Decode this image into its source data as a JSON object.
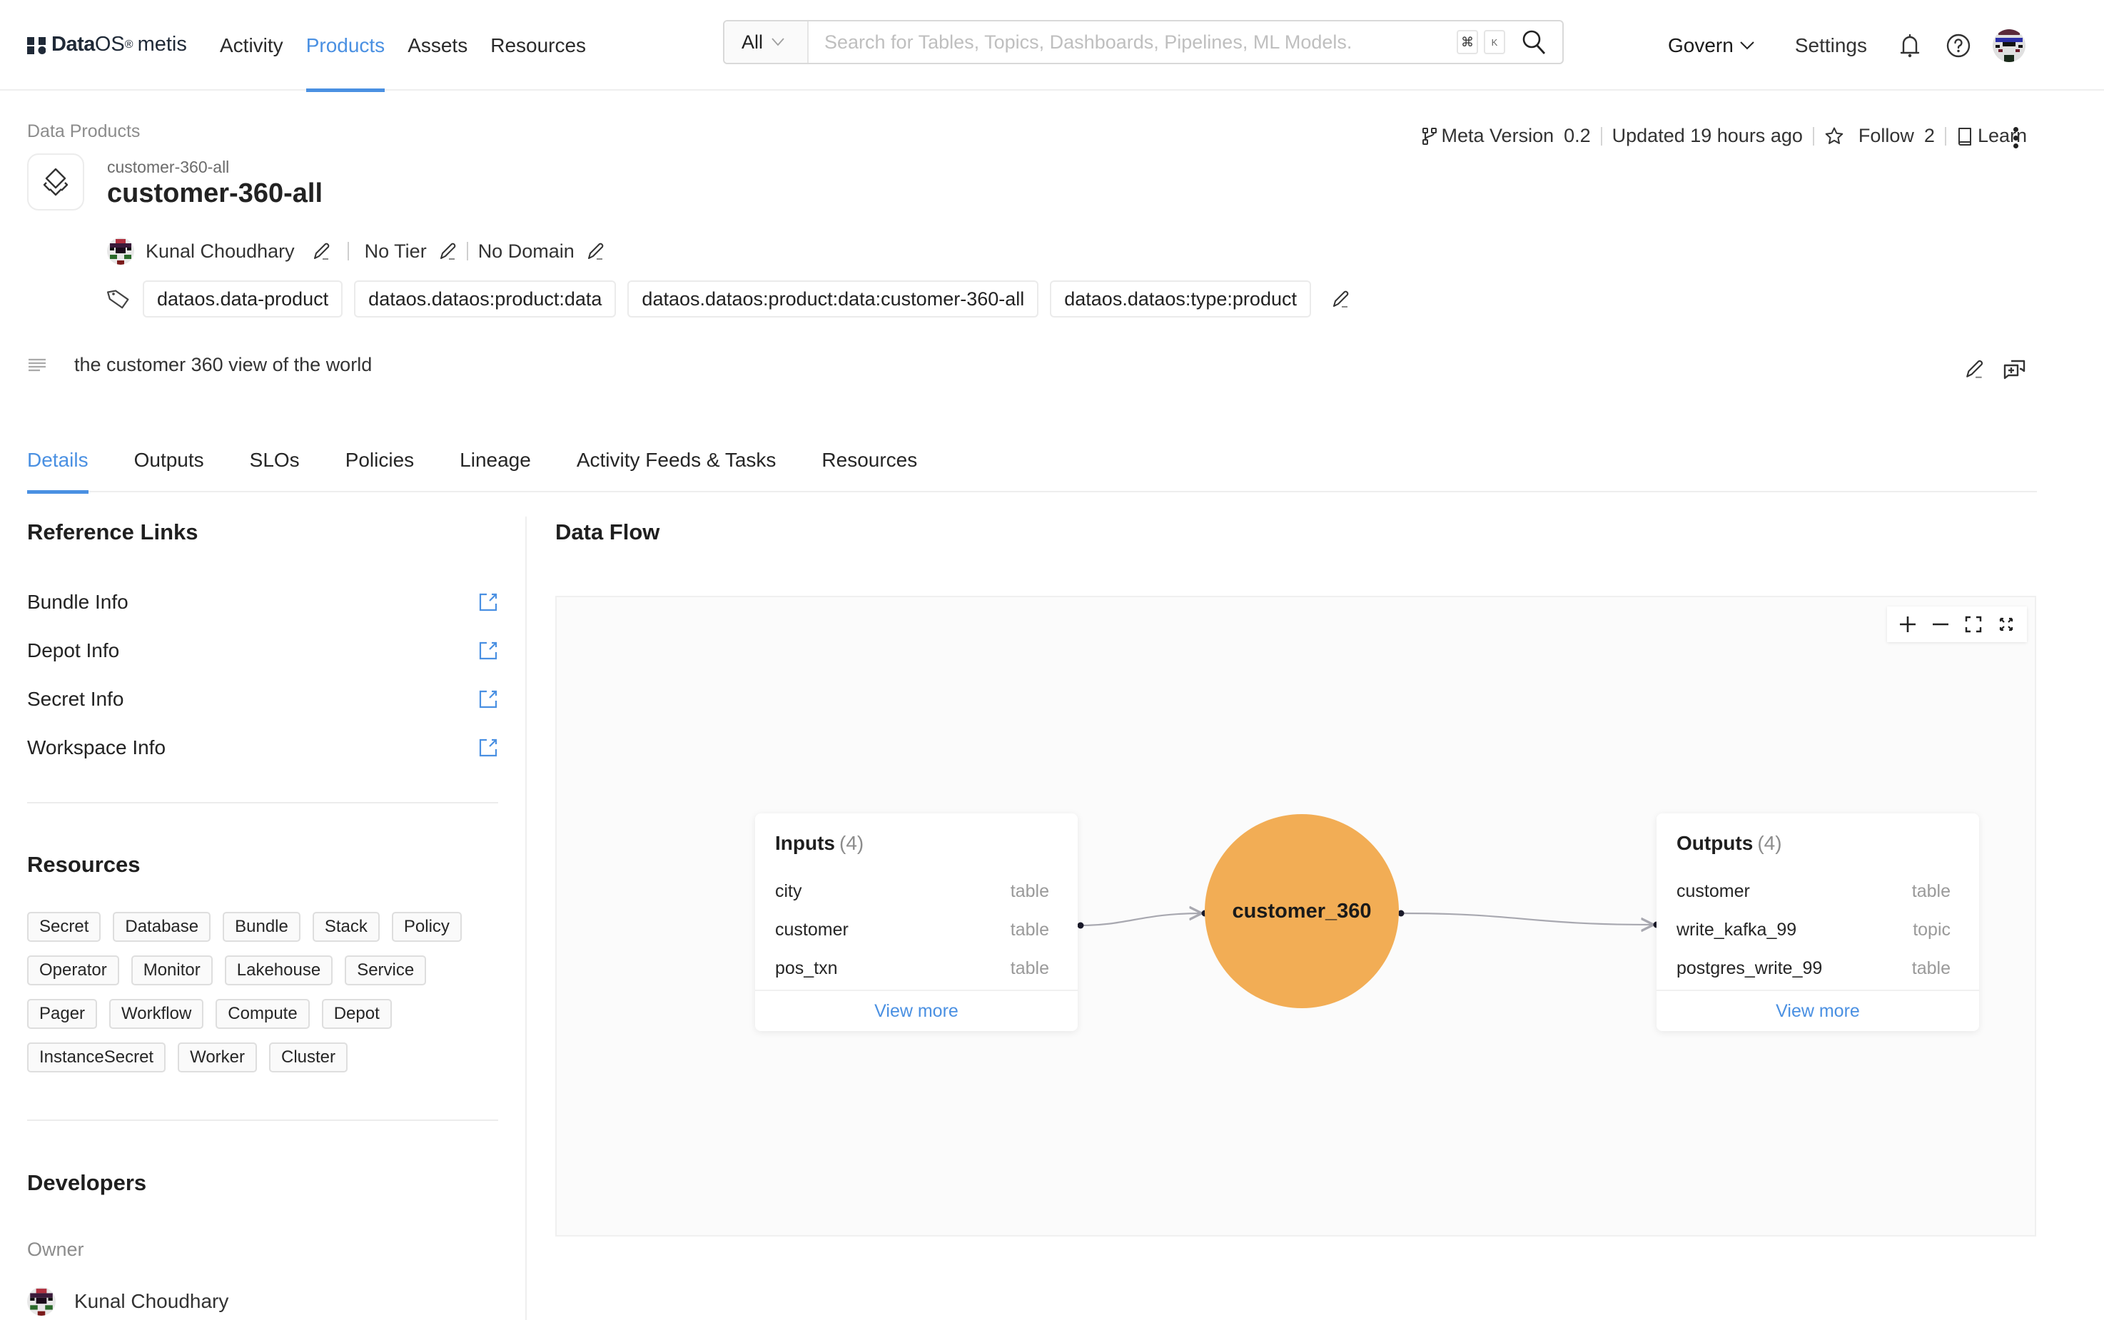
{
  "header": {
    "logo": {
      "brand": "Data",
      "brand_os": "OS",
      "registered": "®",
      "product": "metis"
    },
    "nav": [
      {
        "label": "Activity",
        "active": false
      },
      {
        "label": "Products",
        "active": true
      },
      {
        "label": "Assets",
        "active": false
      },
      {
        "label": "Resources",
        "active": false
      }
    ],
    "search": {
      "type_selected": "All",
      "placeholder": "Search for Tables, Topics, Dashboards, Pipelines, ML Models.",
      "value": "",
      "shortcut_keys": [
        "⌘",
        "K"
      ]
    },
    "govern_label": "Govern",
    "settings_label": "Settings",
    "icons": [
      "bell-icon",
      "help-icon",
      "user-avatar"
    ]
  },
  "entity": {
    "breadcrumb": "Data Products",
    "subtitle": "customer-360-all",
    "title": "customer-360-all",
    "icon": "data-product-icon",
    "meta": {
      "version_label": "Meta Version",
      "version_value": "0.2",
      "updated": "Updated 19 hours ago",
      "follow_label": "Follow",
      "follow_count": "2",
      "learn_label": "Learn"
    },
    "owner": "Kunal Choudhary",
    "tier": "No Tier",
    "domain": "No Domain",
    "tags": [
      "dataos.data-product",
      "dataos.dataos:product:data",
      "dataos.dataos:product:data:customer-360-all",
      "dataos.dataos:type:product"
    ],
    "description": "the customer 360 view of the world"
  },
  "tabs": [
    {
      "label": "Details",
      "active": true
    },
    {
      "label": "Outputs",
      "active": false
    },
    {
      "label": "SLOs",
      "active": false
    },
    {
      "label": "Policies",
      "active": false
    },
    {
      "label": "Lineage",
      "active": false
    },
    {
      "label": "Activity Feeds & Tasks",
      "active": false
    },
    {
      "label": "Resources",
      "active": false
    }
  ],
  "left_panel": {
    "reference_links": {
      "title": "Reference Links",
      "items": [
        "Bundle Info",
        "Depot Info",
        "Secret Info",
        "Workspace Info"
      ]
    },
    "resources": {
      "title": "Resources",
      "items": [
        "Secret",
        "Database",
        "Bundle",
        "Stack",
        "Policy",
        "Operator",
        "Monitor",
        "Lakehouse",
        "Service",
        "Pager",
        "Workflow",
        "Compute",
        "Depot",
        "InstanceSecret",
        "Worker",
        "Cluster"
      ]
    },
    "developers": {
      "title": "Developers",
      "owner_label": "Owner",
      "owner_name": "Kunal Choudhary"
    }
  },
  "data_flow": {
    "title": "Data Flow",
    "controls": [
      "zoom-in",
      "zoom-out",
      "fit-view",
      "fullscreen"
    ],
    "inputs": {
      "title": "Inputs",
      "count": "(4)",
      "rows": [
        {
          "name": "city",
          "type": "table"
        },
        {
          "name": "customer",
          "type": "table"
        },
        {
          "name": "pos_txn",
          "type": "table"
        }
      ],
      "view_more": "View more"
    },
    "node": {
      "label": "customer_360",
      "color": "#f2ad55"
    },
    "outputs": {
      "title": "Outputs",
      "count": "(4)",
      "rows": [
        {
          "name": "customer",
          "type": "table"
        },
        {
          "name": "write_kafka_99",
          "type": "topic"
        },
        {
          "name": "postgres_write_99",
          "type": "table"
        }
      ],
      "view_more": "View more"
    }
  },
  "colors": {
    "accent": "#4a90e2",
    "node": "#f2ad55",
    "text": "#1f1f1f",
    "muted": "#8c8c8c"
  }
}
